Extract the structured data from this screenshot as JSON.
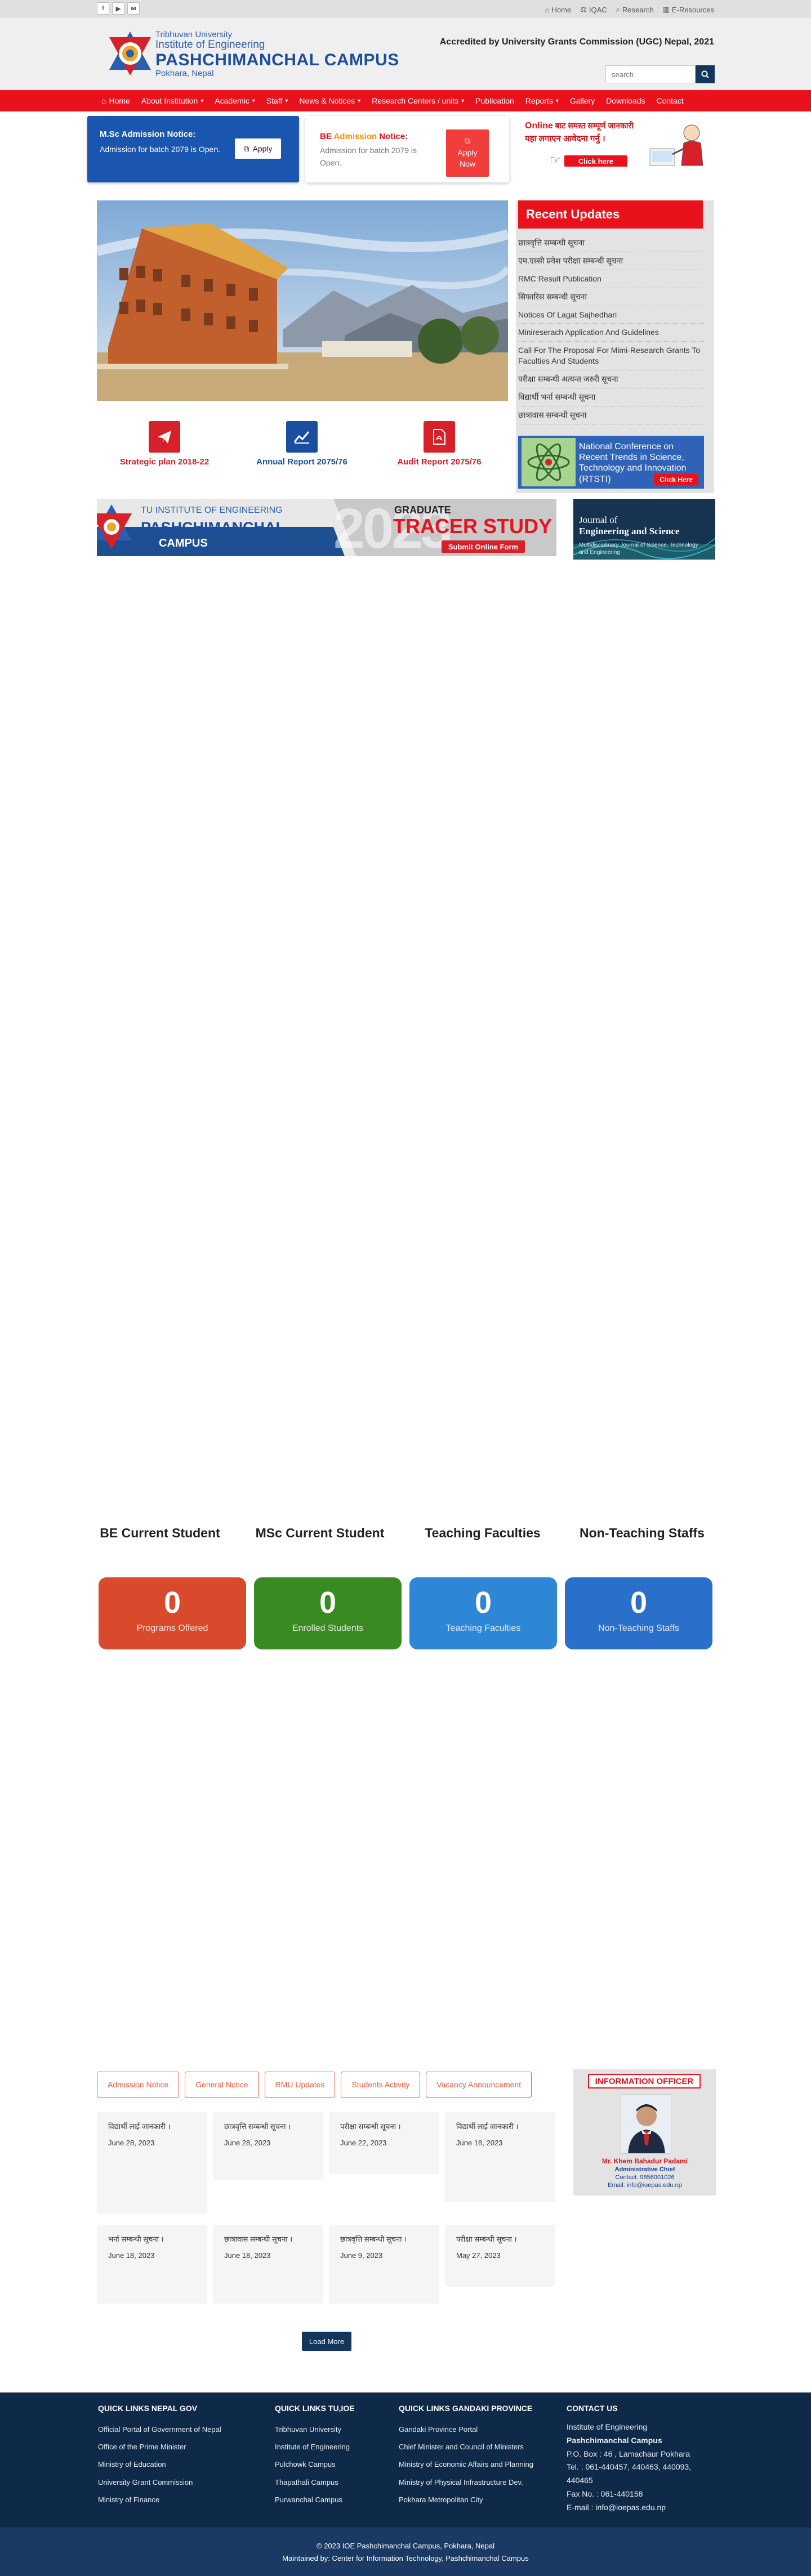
{
  "topbar": {
    "social": [
      "f",
      "▶",
      "✉"
    ],
    "links": [
      {
        "icon": "home-icon",
        "glyph": "⌂",
        "label": "Home"
      },
      {
        "icon": "iqac-icon",
        "glyph": "⚖",
        "label": "IQAC"
      },
      {
        "icon": "research-icon",
        "glyph": "⌕",
        "label": "Research"
      },
      {
        "icon": "resources-icon",
        "glyph": "▥",
        "label": "E-Resources"
      }
    ]
  },
  "header": {
    "logo_line1": "Tribhuvan University",
    "logo_line2": "Institute of Engineering",
    "logo_line3": "PASHCHIMANCHAL CAMPUS",
    "logo_line4": "Pokhara, Nepal",
    "accreditation": "Accredited by University Grants Commission (UGC) Nepal, 2021",
    "search_placeholder": "search"
  },
  "nav": {
    "items": [
      {
        "label": "Home",
        "dropdown": false
      },
      {
        "label": "About Institution",
        "dropdown": true
      },
      {
        "label": "Academic",
        "dropdown": true
      },
      {
        "label": "Staff",
        "dropdown": true
      },
      {
        "label": "News & Notices",
        "dropdown": true
      },
      {
        "label": "Research Centers / units",
        "dropdown": true
      },
      {
        "label": "Publication",
        "dropdown": false
      },
      {
        "label": "Reports",
        "dropdown": true
      },
      {
        "label": "Gallery",
        "dropdown": false
      },
      {
        "label": "Downloads",
        "dropdown": false
      },
      {
        "label": "Contact",
        "dropdown": false
      }
    ]
  },
  "notices": {
    "msc": {
      "title": "M.Sc Admission Notice:",
      "body": "Admission for batch 2079 is Open.",
      "button": "Apply"
    },
    "be": {
      "title_prefix": "BE ",
      "title_highlight": "Admission",
      "title_suffix": " Notice:",
      "body": "Admission for batch 2079 is Open.",
      "button": "Apply Now"
    },
    "online": {
      "line1_en": "Online",
      "line1_np": " बाट समस्त सम्पूर्ण जानकारी",
      "line2": "यहा लगाएन आवेदना गर्नु ।",
      "button": "Click here"
    }
  },
  "updates": {
    "title": "Recent Updates",
    "items": [
      "छात्रवृत्ति सम्बन्धी सूचना",
      "एम.एस्सी प्रवेश परीक्षा सम्बन्धी सूचना",
      "RMC Result Publication",
      "सिफारिस सम्बन्धी सूचना",
      "Notices Of Lagat Sajhedhari",
      "Minireserach Application And Guidelines",
      "Call For The Proposal For Mimi-Research Grants To Faculties And Students",
      "परीक्षा सम्बन्धी अत्यन्त जरुरी सूचना",
      "विद्यार्थी भर्ना सम्बन्धी सूचना",
      "छात्रावास सम्बन्धी सूचना"
    ],
    "conference": "National Conference on Recent Trends in Science, Technology and Innovation (RTSTI)",
    "conference_button": "Click Here"
  },
  "quick_links": [
    {
      "label": "Strategic plan 2018-22",
      "icon": "paper-plane-icon",
      "color": "#d6202a"
    },
    {
      "label": "Annual Report 2075/76",
      "icon": "chart-line-icon",
      "color": "#1a4fa0"
    },
    {
      "label": "Audit Report 2075/76",
      "icon": "pdf-file-icon",
      "color": "#d6202a"
    }
  ],
  "tracer": {
    "tu": "TU INSTITUTE OF ENGINEERING",
    "name1": "PASHCHIMANCHAL",
    "name2": "CAMPUS",
    "year": "2023",
    "graduate": "GRADUATE",
    "study": "TRACER STUDY",
    "submit": "Submit Online Form"
  },
  "journal": {
    "line1": "Journal of",
    "line2": "Engineering and Science",
    "subtitle": "Multidisciplinary Journal of Science, Technology and Engineering"
  },
  "stats": [
    {
      "title": "BE Current Student",
      "value": "0",
      "caption": "Programs Offered",
      "color": "#d84a2b"
    },
    {
      "title": "MSc Current Student",
      "value": "0",
      "caption": "Enrolled Students",
      "color": "#3a8a22"
    },
    {
      "title": "Teaching Faculties",
      "value": "0",
      "caption": "Teaching Faculties",
      "color": "#2d86d6"
    },
    {
      "title": "Non-Teaching Staffs",
      "value": "0",
      "caption": "Non-Teaching Staffs",
      "color": "#2a6fc9"
    }
  ],
  "notice_tabs": [
    "Admission Notice",
    "General Notice",
    "RMU Updates",
    "Students Activity",
    "Vacancy Announcement"
  ],
  "notice_cards": [
    {
      "title": "विद्यार्थी लाई जानकारी ।",
      "date": "June 28, 2023"
    },
    {
      "title": "छात्रवृत्ति सम्बन्धी सूचना ।",
      "date": "June 28, 2023"
    },
    {
      "title": "परीक्षा सम्बन्धी सूचना ।",
      "date": "June 22, 2023"
    },
    {
      "title": "विद्यार्थी लाई जानकारी ।",
      "date": "June 18, 2023"
    },
    {
      "title": "भर्ना सम्बन्धी सूचना ।",
      "date": "June 18, 2023"
    },
    {
      "title": "छात्रावास सम्बन्धी सूचना ।",
      "date": "June 18, 2023"
    },
    {
      "title": "छात्रवृत्ति सम्बन्धी सूचना ।",
      "date": "June 9, 2023"
    },
    {
      "title": "परीक्षा सम्बन्धी सूचना ।",
      "date": "May 27, 2023"
    }
  ],
  "load_more": "Load More",
  "info_officer": {
    "title": "INFORMATION OFFICER",
    "name": "Mr. Khem Bahadur Padami",
    "designation": "Administrative Chief",
    "contact": "Contact: 9856001026",
    "email": "Email: info@ioepas.edu.np"
  },
  "footer": {
    "col1": {
      "title": "QUICK LINKS NEPAL GOV",
      "links": [
        "Official Portal of Government of Nepal",
        "Office of the Prime Minister",
        "Ministry of Education",
        "University Grant Commission",
        "Ministry of Finance"
      ]
    },
    "col2": {
      "title": "QUICK LINKS TU,IOE",
      "links": [
        "Tribhuvan University",
        "Institute of Engineering",
        "Pulchowk Campus",
        "Thapathali Campus",
        "Purwanchal Campus"
      ]
    },
    "col3": {
      "title": "QUICK LINKS GANDAKI PROVINCE",
      "links": [
        "Gandaki Province Portal",
        "Chief Minister and Council of Ministers",
        "Ministry of Economic Affairs and Planning",
        "Ministry of Physical Infrastructure Dev.",
        "Pokhara Metropolitan City"
      ]
    },
    "contact": {
      "title": "CONTACT US",
      "line1": "Institute of Engineering",
      "line2": "Pashchimanchal Campus",
      "line3": "P.O. Box : 46 , Lamachaur Pokhara",
      "line4": "Tel. : 061-440457, 440463, 440093, 440465",
      "line5": "Fax No. : 061-440158",
      "line6": "E-mail : info@ioepas.edu.np"
    },
    "copyright": "© 2023 IOE Pashchimanchal Campus, Pokhara, Nepal",
    "maintained": "Maintained by: Center for Information Technology, Pashchimanchal Campus"
  }
}
